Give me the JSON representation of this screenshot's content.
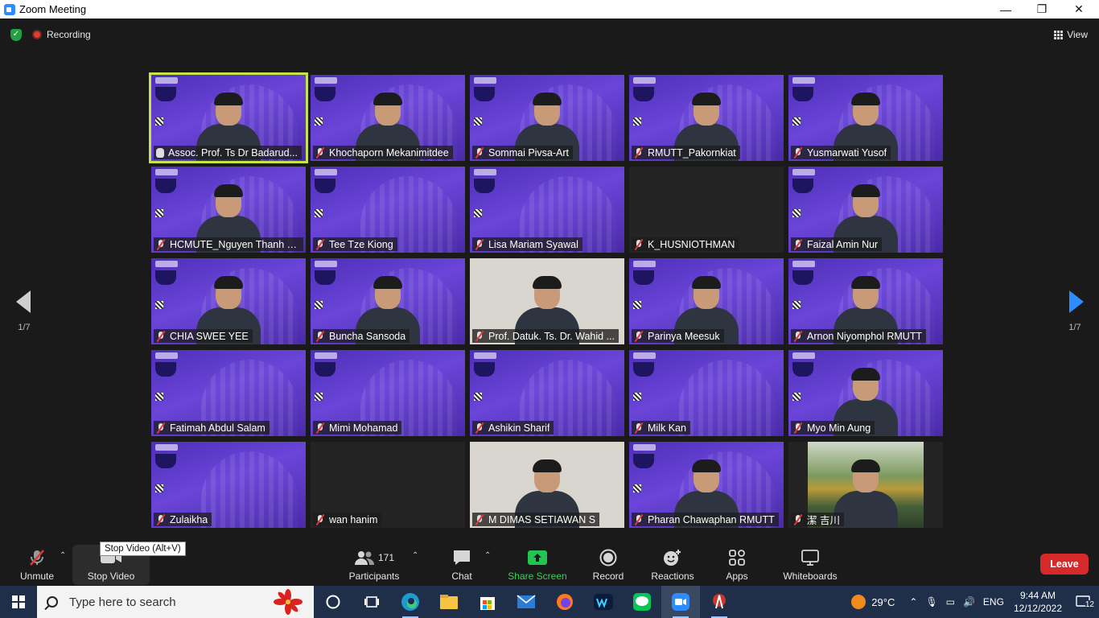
{
  "window": {
    "title": "Zoom Meeting"
  },
  "meeting": {
    "recording_label": "Recording",
    "view_label": "View",
    "page_indicator_left": "1/7",
    "page_indicator_right": "1/7",
    "tiles": [
      {
        "name": "Assoc. Prof. Ts Dr Badarud...",
        "bg": "purple",
        "person": true,
        "speaker": true
      },
      {
        "name": "Khochaporn Mekanimitdee",
        "bg": "purple",
        "person": true
      },
      {
        "name": "Sommai Pivsa-Art",
        "bg": "purple",
        "person": true
      },
      {
        "name": "RMUTT_Pakornkiat",
        "bg": "purple",
        "person": true
      },
      {
        "name": "Yusmarwati Yusof",
        "bg": "purple",
        "person": true
      },
      {
        "name": "HCMUTE_Nguyen Thanh T...",
        "bg": "purple",
        "person": true
      },
      {
        "name": "Tee Tze Kiong",
        "bg": "purple",
        "person": false
      },
      {
        "name": "Lisa Mariam Syawal",
        "bg": "purple",
        "person": false
      },
      {
        "name": "K_HUSNIOTHMAN",
        "bg": "black",
        "person": false
      },
      {
        "name": "Faizal Amin Nur",
        "bg": "purple",
        "person": true
      },
      {
        "name": "CHIA SWEE YEE",
        "bg": "purple",
        "person": true
      },
      {
        "name": "Buncha Sansoda",
        "bg": "purple",
        "person": true
      },
      {
        "name": "Prof. Datuk. Ts. Dr. Wahid ...",
        "bg": "photo",
        "person": true
      },
      {
        "name": "Parinya Meesuk",
        "bg": "purple",
        "person": true
      },
      {
        "name": "Arnon Niyomphol RMUTT",
        "bg": "purple",
        "person": true
      },
      {
        "name": "Fatimah Abdul Salam",
        "bg": "purple",
        "person": false
      },
      {
        "name": "Mimi Mohamad",
        "bg": "purple",
        "person": false
      },
      {
        "name": "Ashikin Sharif",
        "bg": "purple",
        "person": false
      },
      {
        "name": "Milk Kan",
        "bg": "purple",
        "person": false
      },
      {
        "name": "Myo Min Aung",
        "bg": "purple",
        "person": true
      },
      {
        "name": "Zulaikha",
        "bg": "purple",
        "person": false
      },
      {
        "name": "wan hanim",
        "bg": "black",
        "person": false
      },
      {
        "name": "M DIMAS SETIAWAN S",
        "bg": "photo",
        "person": true
      },
      {
        "name": "Pharan Chawaphan RMUTT",
        "bg": "purple",
        "person": true
      },
      {
        "name": "潔 吉川",
        "bg": "kinkaku",
        "person": true
      }
    ]
  },
  "toolbar": {
    "unmute": "Unmute",
    "stop_video": "Stop Video",
    "tooltip": "Stop Video (Alt+V)",
    "participants": "Participants",
    "participants_count": "171",
    "chat": "Chat",
    "share_screen": "Share Screen",
    "record": "Record",
    "reactions": "Reactions",
    "apps": "Apps",
    "whiteboards": "Whiteboards",
    "leave": "Leave",
    "colors": {
      "leave": "#d62a2a",
      "share": "#3ecf5a",
      "speaker_border": "#c6e34a",
      "nav_arrow": "#2d8cff"
    }
  },
  "taskbar": {
    "search_placeholder": "Type here to search",
    "weather": "29°C",
    "language": "ENG",
    "time": "9:44 AM",
    "date": "12/12/2022",
    "notifications": "12"
  }
}
